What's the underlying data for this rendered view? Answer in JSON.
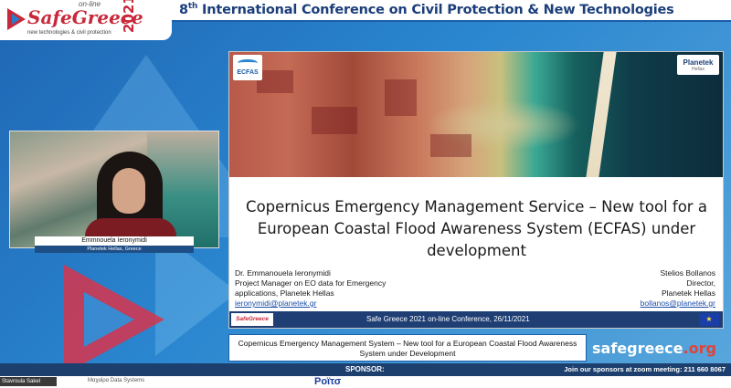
{
  "header": {
    "title_main": "8",
    "title_sup": "th",
    "title_rest": " International Conference on Civil Protection & New Technologies"
  },
  "logo": {
    "online": "on-line",
    "name": "SafeGreece",
    "year": "2021",
    "tagline": "new technologies & civil protection"
  },
  "speaker": {
    "name": "Emmnouela Ieronymidi",
    "affiliation": "Planetek Hellas, Greece"
  },
  "slide": {
    "logo_left": "ECFAS",
    "logo_right": "Planetek",
    "logo_right_sub": "Hellas",
    "title": "Copernicus Emergency Management Service – New tool for a European Coastal Flood Awareness System (ECFAS) under development",
    "author_left": {
      "name": "Dr. Emmanouela Ieronymidi",
      "role_line1": "Project Manager on EO data for Emergency",
      "role_line2": "applications, Planetek Hellas",
      "email": "ieronymidi@planetek.gr"
    },
    "author_right": {
      "name": "Stelios Bollanos",
      "role_line1": "Director,",
      "role_line2": "Planetek Hellas",
      "email": "bollanos@planetek.gr"
    },
    "footer_text": "Safe Greece 2021 on-line Conference, 26/11/2021",
    "footer_logo": "SafeGreece"
  },
  "caption": {
    "text": "Copernicus Emergency Management System – New tool for a European Coastal Flood Awareness System under Development"
  },
  "site_url": {
    "main": "safegreece",
    "tld": ".org"
  },
  "sponsor_bar": {
    "label": "SPONSOR:",
    "zoom_text": "Join our sponsors at zoom meeting: 211 660 8067"
  },
  "bottom": {
    "user_tag": "Stavroula Sakel",
    "sponsor1": "Μαχαίρα Data Systems",
    "sponsor2": "Ροϊτσ"
  },
  "colors": {
    "accent_blue": "#1c5ea8",
    "brand_red": "#c8283a",
    "footer_navy": "#1e3e74"
  }
}
